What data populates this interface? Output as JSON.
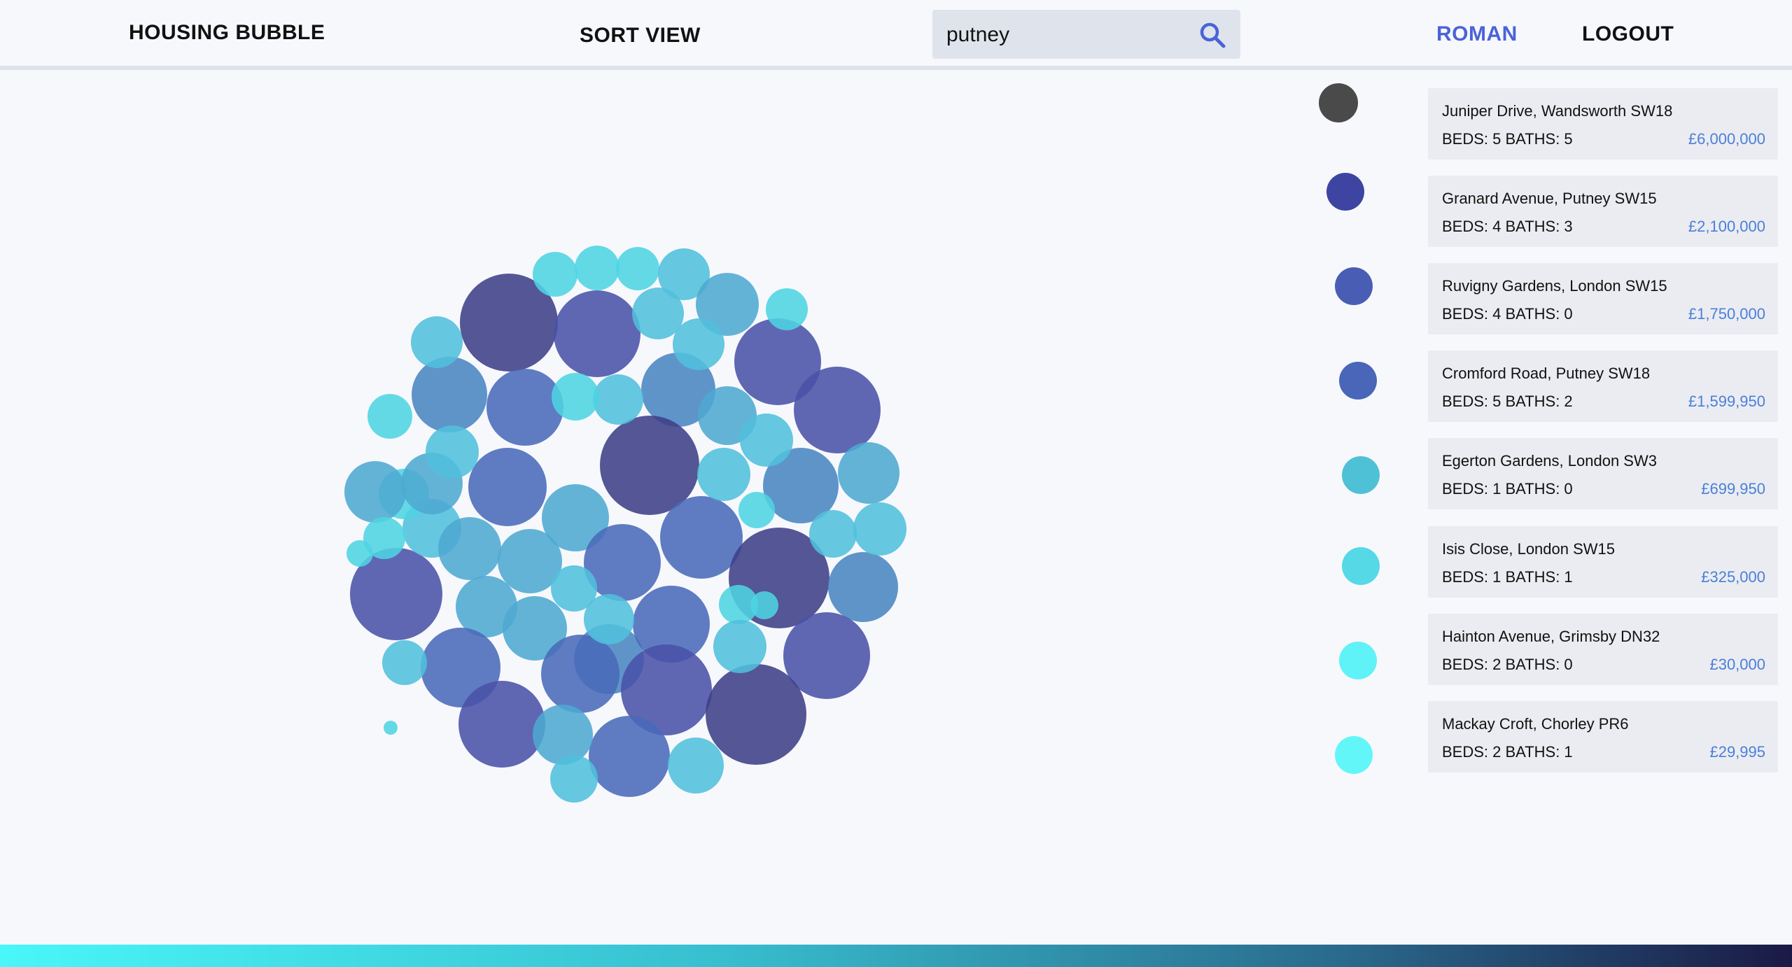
{
  "nav": {
    "brand": "HOUSING BUBBLE",
    "sort_view": "SORT VIEW",
    "user": "ROMAN",
    "logout": "LOGOUT"
  },
  "search": {
    "value": "putney",
    "icon": "search-icon"
  },
  "colors": {
    "accent": "#4a63d8",
    "price": "#4a7fd9",
    "bubble_palette": [
      "#3f3f86",
      "#4a52a8",
      "#4a6ab9",
      "#4a85c2",
      "#4fa8d1",
      "#51bfdc",
      "#4fd4e2"
    ]
  },
  "listings": [
    {
      "address": "Juniper Drive, Wandsworth SW18",
      "specs": "BEDS: 5 BATHS: 5",
      "price": "£6,000,000",
      "color": "#4a4a4a"
    },
    {
      "address": "Granard Avenue, Putney SW15",
      "specs": "BEDS: 4 BATHS: 3",
      "price": "£2,100,000",
      "color": "#3d44a2"
    },
    {
      "address": "Ruvigny Gardens, London SW15",
      "specs": "BEDS: 4 BATHS: 0",
      "price": "£1,750,000",
      "color": "#4a5db4"
    },
    {
      "address": "Cromford Road, Putney SW18",
      "specs": "BEDS: 5 BATHS: 2",
      "price": "£1,599,950",
      "color": "#4a66b8"
    },
    {
      "address": "Egerton Gardens, London SW3",
      "specs": "BEDS: 1 BATHS: 0",
      "price": "£699,950",
      "color": "#4fc1d6"
    },
    {
      "address": "Isis Close, London SW15",
      "specs": "BEDS: 1 BATHS: 1",
      "price": "£325,000",
      "color": "#55d9e6"
    },
    {
      "address": "Hainton Avenue, Grimsby DN32",
      "specs": "BEDS: 2 BATHS: 0",
      "price": "£30,000",
      "color": "#5ff2f6"
    },
    {
      "address": "Mackay Croft, Chorley PR6",
      "specs": "BEDS: 2 BATHS: 1",
      "price": "£29,995",
      "color": "#62f6f8"
    }
  ]
}
